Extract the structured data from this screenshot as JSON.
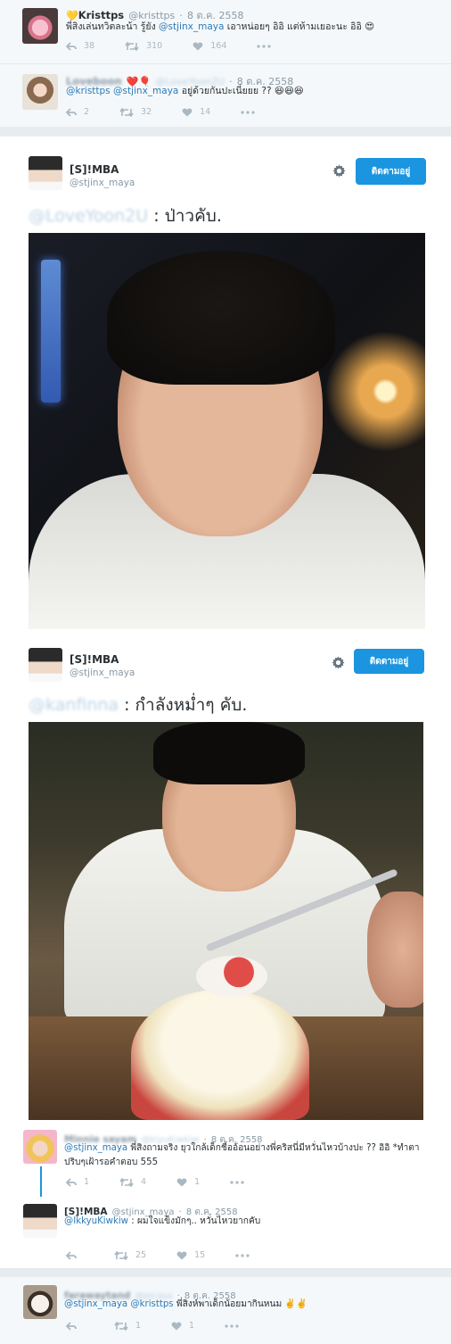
{
  "tweet1": {
    "name": "Kristtps",
    "handle": "@kristtps",
    "date": "8 ต.ค. 2558",
    "text_pre": "พี่สิงเล่นทวิตละน้า รู้ยัง ",
    "mention": "@stjinx_maya",
    "text_post": " เอาหน่อยๆ อิอิ แต่ห้ามเยอะนะ อิอิ 😍",
    "replies": "38",
    "retweets": "310",
    "likes": "164",
    "emoji_heart": "💛"
  },
  "tweet2": {
    "name": "Loveboon",
    "name_emoji": "❤️🎈",
    "handle": "@LoveYoon2U",
    "date": "8 ต.ค. 2558",
    "mention1": "@kristtps",
    "mention2": "@stjinx_maya",
    "text": " อยู่ด้วยกันปะเนี่ยยย ?? 😆😆😆",
    "replies": "2",
    "retweets": "32",
    "likes": "14"
  },
  "main1": {
    "name": "[S]!MBA",
    "handle": "@stjinx_maya",
    "follow_label": "ติดตามอยู่",
    "mention": "@LoveYoon2U",
    "text": " : ป่าวคับ."
  },
  "main2": {
    "name": "[S]!MBA",
    "handle": "@stjinx_maya",
    "follow_label": "ติดตามอยู่",
    "mention": "@kanfinna",
    "text": " : กำลังหม่ำๆ คับ."
  },
  "reply1": {
    "name": "Minnie sayam",
    "handle": "@kiyuKiwkiw",
    "date": "8 ต.ค. 2558",
    "mention": "@stjinx_maya",
    "text_line1": " พี่สิงถามจริง ยุวใกล้เด็กชื่ออ้อนอย่างพี่คริสนี่มีหวั่นไหวบ้างปะ ?? อิอิ *ทำตา",
    "text_line2": "ปริบๆเฝ้ารอคำตอบ 555",
    "replies": "1",
    "retweets": "4",
    "likes": "1"
  },
  "reply2": {
    "name": "[S]!MBA",
    "handle": "@stjinx_maya",
    "date": "8 ต.ค. 2558",
    "mention": "@IkkyuKiwkiw",
    "text": " : ผมใจแข็งมักๆ.. หวั่นไหวยากคับ",
    "retweets": "25",
    "likes": "15"
  },
  "reply3": {
    "name": "farawaytand",
    "handle": "@picasa",
    "date": "8 ต.ค. 2558",
    "mention1": "@stjinx_maya",
    "mention2": "@kristtps",
    "text": " พี่สิงห์พาเด็กน้อยมากินหนม ✌️✌️",
    "retweets": "1",
    "likes": "1"
  },
  "colors": {
    "accent": "#1b95e0",
    "mention": "#2b7bb9",
    "muted": "#aab8c2"
  }
}
